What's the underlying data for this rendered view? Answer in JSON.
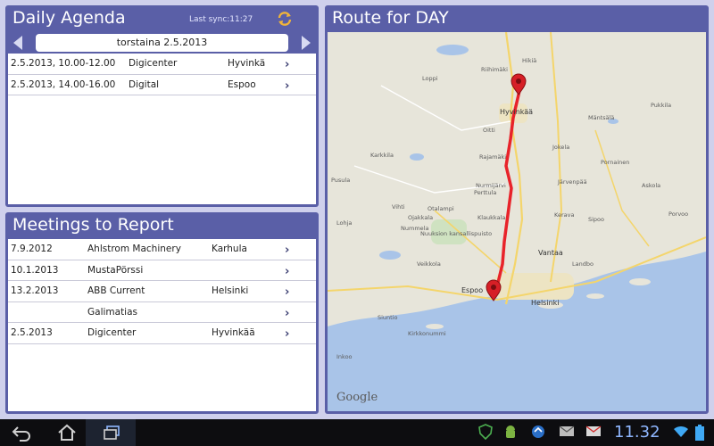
{
  "agenda": {
    "title": "Daily Agenda",
    "last_sync": "Last sync:11:27",
    "date": "torstaina 2.5.2013",
    "rows": [
      {
        "when": "2.5.2013, 10.00-12.00",
        "customer": "Digicenter",
        "city": "Hyvinkä"
      },
      {
        "when": "2.5.2013, 14.00-16.00",
        "customer": "Digital",
        "city": "Espoo"
      }
    ]
  },
  "meetings": {
    "title": "Meetings to Report",
    "rows": [
      {
        "date": "7.9.2012",
        "customer": "Ahlstrom Machinery",
        "city": "Karhula"
      },
      {
        "date": "10.1.2013",
        "customer": "MustaPörssi",
        "city": ""
      },
      {
        "date": "13.2.2013",
        "customer": "ABB Current",
        "city": "Helsinki"
      },
      {
        "date": "",
        "customer": "Galimatias",
        "city": ""
      },
      {
        "date": "2.5.2013",
        "customer": "Digicenter",
        "city": "Hyvinkää"
      }
    ]
  },
  "route": {
    "title": "Route for DAY",
    "attribution": "Google",
    "places": {
      "hyvinkaa": "Hyvinkää",
      "espoo": "Espoo",
      "helsinki": "Helsinki",
      "vantaa": "Vantaa",
      "kerava": "Kerava",
      "jokela": "Jokela",
      "nurmijarvi": "Nurmijärvi",
      "klaukkala": "Klaukkala",
      "rajamaki": "Rajamäki",
      "porvoo": "Porvoo",
      "sipoo": "Sipoo",
      "lohja": "Lohja",
      "vihti": "Vihti",
      "karkkila": "Karkkila",
      "kirkkonummi": "Kirkkonummi",
      "siuntio": "Siuntio",
      "inkoo": "Inkoo",
      "jarvenpaa": "Järvenpää",
      "mantsala": "Mäntsälä",
      "riihimaki": "Riihimäki",
      "hikia": "Hikiä",
      "loppi": "Loppi",
      "pusula": "Pusula",
      "nummela": "Nummela",
      "otalampi": "Otalampi",
      "pukkila": "Pukkila",
      "askola": "Askola",
      "pornainen": "Pornainen",
      "landbo": "Landbo",
      "perttula": "Perttula",
      "oitti": "Oitti",
      "ojakkala": "Ojakkala",
      "veikkola": "Veikkola",
      "nuuksio": "Nuuksion kansallispuisto"
    }
  },
  "statusbar": {
    "time": "11.32"
  },
  "colors": {
    "panel": "#5a5fa7",
    "background": "#cfd0ec",
    "route_line": "#e8232a",
    "water": "#a9c4e8"
  },
  "icons": {
    "refresh": "refresh-icon",
    "back": "back-icon",
    "home": "home-icon",
    "recent": "recent-apps-icon",
    "wifi": "wifi-icon"
  }
}
